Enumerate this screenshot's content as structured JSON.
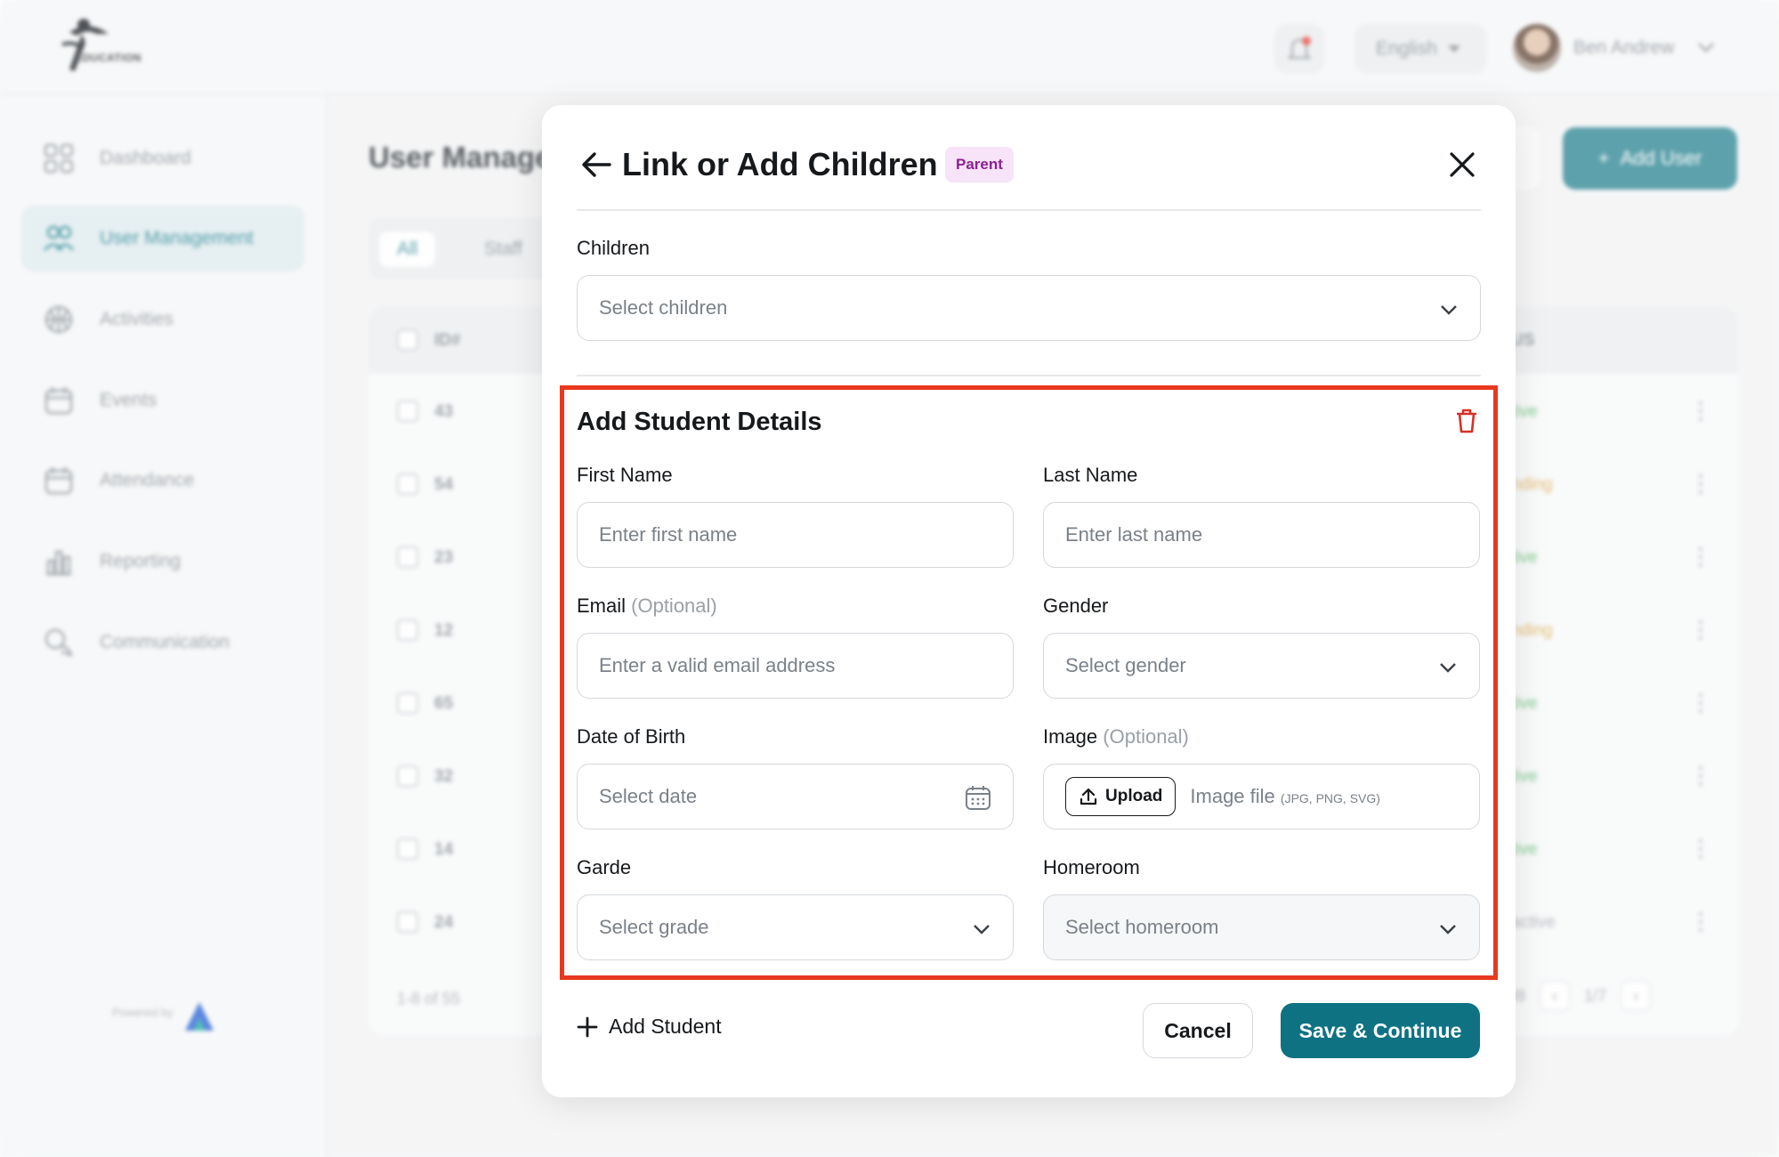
{
  "brand": {
    "logo_text": "EDUCATION",
    "powered_by": "Powered by"
  },
  "topbar": {
    "language": "English",
    "user_name": "Ben Andrew"
  },
  "sidebar": {
    "items": [
      {
        "label": "Dashboard",
        "icon": "grid-icon"
      },
      {
        "label": "User Management",
        "icon": "users-icon",
        "active": true
      },
      {
        "label": "Activities",
        "icon": "basketball-icon"
      },
      {
        "label": "Events",
        "icon": "calendar-icon"
      },
      {
        "label": "Attendance",
        "icon": "calendar-check-icon"
      },
      {
        "label": "Reporting",
        "icon": "bar-chart-icon"
      },
      {
        "label": "Communication",
        "icon": "chat-icon"
      }
    ]
  },
  "main": {
    "title": "User Manage",
    "add_user_label": "Add User",
    "tabs": [
      "All",
      "Staff"
    ],
    "table": {
      "id_header": "ID#",
      "status_header": "US",
      "rows": [
        {
          "id": "43",
          "status": "tive",
          "status_color": "#6cc27a"
        },
        {
          "id": "54",
          "status": "nding",
          "status_color": "#e0b25a"
        },
        {
          "id": "23",
          "status": "tive",
          "status_color": "#6cc27a"
        },
        {
          "id": "12",
          "status": "nding",
          "status_color": "#e0b25a"
        },
        {
          "id": "65",
          "status": "tive",
          "status_color": "#6cc27a"
        },
        {
          "id": "32",
          "status": "tive",
          "status_color": "#6cc27a"
        },
        {
          "id": "14",
          "status": "tive",
          "status_color": "#6cc27a"
        },
        {
          "id": "24",
          "status": "active",
          "status_color": "#aab0b5"
        }
      ],
      "pager_summary": "1-8 of 55",
      "per_page": "08",
      "page_indicator": "1/7"
    }
  },
  "modal": {
    "title": "Link or Add Children",
    "badge": "Parent",
    "children": {
      "label": "Children",
      "placeholder": "Select children"
    },
    "student_section": {
      "title": "Add Student Details",
      "first_name": {
        "label": "First Name",
        "placeholder": "Enter first name"
      },
      "last_name": {
        "label": "Last Name",
        "placeholder": "Enter last name"
      },
      "email": {
        "label": "Email",
        "optional": "(Optional)",
        "placeholder": "Enter a valid email address"
      },
      "gender": {
        "label": "Gender",
        "placeholder": "Select gender"
      },
      "dob": {
        "label": "Date of Birth",
        "placeholder": "Select date"
      },
      "image": {
        "label": "Image",
        "optional": "(Optional)",
        "upload_label": "Upload",
        "hint": "Image file",
        "formats": "(JPG, PNG, SVG)"
      },
      "grade": {
        "label": "Garde",
        "placeholder": "Select grade"
      },
      "homeroom": {
        "label": "Homeroom",
        "placeholder": "Select homeroom"
      }
    },
    "add_student_label": "Add Student",
    "cancel_label": "Cancel",
    "save_label": "Save & Continue"
  },
  "colors": {
    "accent": "#0e7283",
    "highlight": "#e8391f",
    "badge_bg": "#f7e4f8",
    "badge_text": "#8d1f95"
  }
}
